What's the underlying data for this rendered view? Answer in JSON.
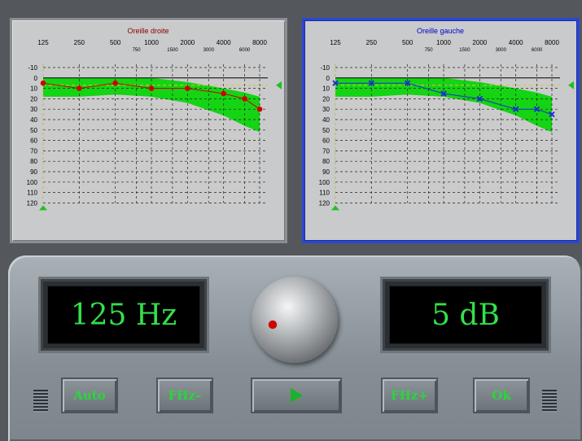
{
  "audiograms": {
    "right": {
      "title": "Oreille droite",
      "title_color": "#8b0000",
      "series_color": "#cc0000",
      "marker": "circle",
      "values": [
        5,
        10,
        5,
        10,
        10,
        15,
        20,
        30
      ]
    },
    "left": {
      "title": "Oreille gauche",
      "title_color": "#0000cc",
      "series_color": "#1b2fd0",
      "marker": "cross",
      "values": [
        5,
        5,
        5,
        15,
        20,
        30,
        30,
        35
      ]
    },
    "freq_labels_top": [
      "125",
      "250",
      "500",
      "1000",
      "2000",
      "4000",
      "8000"
    ],
    "freq_labels_mid": [
      "750",
      "1500",
      "3000",
      "6000"
    ],
    "db_labels": [
      "-10",
      "0",
      "10",
      "20",
      "30",
      "40",
      "50",
      "60",
      "70",
      "80",
      "90",
      "100",
      "110",
      "120"
    ],
    "normal_band_color": "#14d414"
  },
  "chart_data": [
    {
      "type": "line",
      "title": "Oreille droite",
      "x": [
        125,
        250,
        500,
        1000,
        2000,
        4000,
        6000,
        8000
      ],
      "y": [
        5,
        10,
        5,
        10,
        10,
        15,
        20,
        30
      ],
      "ylim": [
        -10,
        120
      ],
      "xscale": "log"
    },
    {
      "type": "line",
      "title": "Oreille gauche",
      "x": [
        125,
        250,
        500,
        1000,
        2000,
        4000,
        6000,
        8000
      ],
      "y": [
        5,
        5,
        5,
        15,
        20,
        30,
        30,
        35
      ],
      "ylim": [
        -10,
        120
      ],
      "xscale": "log"
    }
  ],
  "controls": {
    "frequency_display": "125 Hz",
    "level_display": "5 dB",
    "auto_label": "Auto",
    "fhz_minus_label": "FHz–",
    "fhz_plus_label": "FHz+",
    "ok_label": "Ok"
  }
}
